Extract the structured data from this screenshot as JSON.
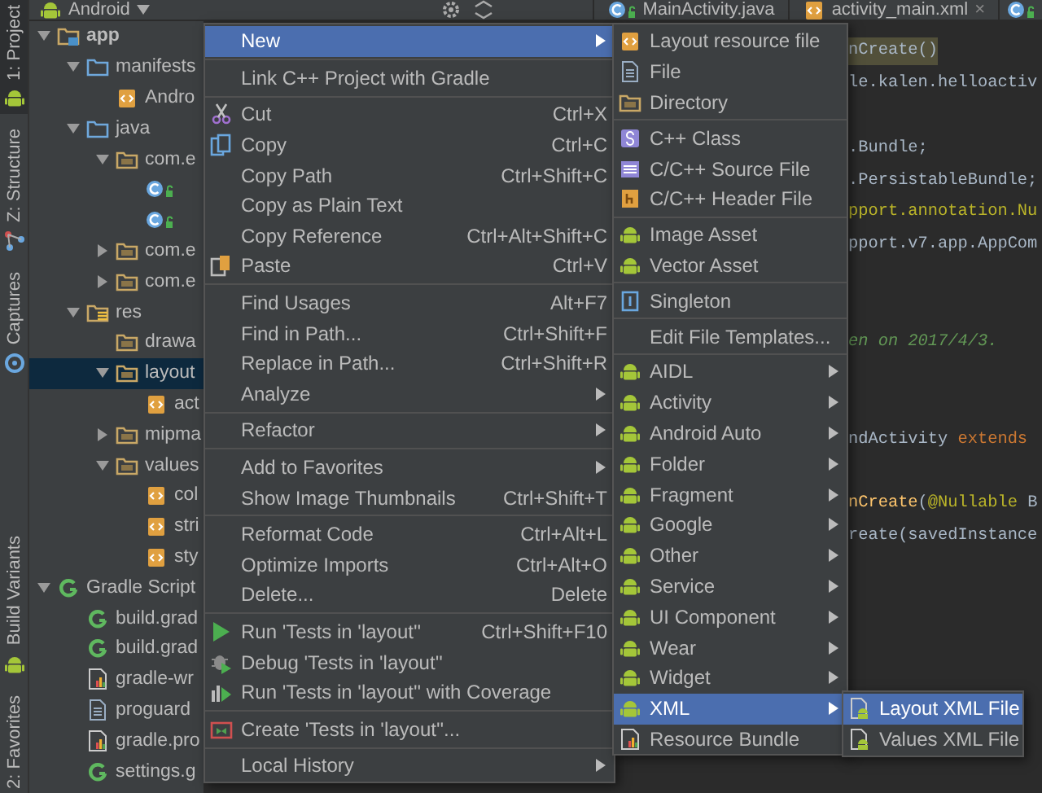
{
  "tool_strip": {
    "top": [
      {
        "label": "1: Project",
        "kind": "android",
        "selected": true
      },
      {
        "label": "Z: Structure",
        "kind": "structure",
        "selected": false
      },
      {
        "label": "Captures",
        "kind": "captures",
        "selected": false
      }
    ],
    "bottom": [
      {
        "label": "Build Variants",
        "kind": "android",
        "selected": false
      },
      {
        "label": "2: Favorites",
        "kind": "plain",
        "selected": false
      }
    ]
  },
  "top_bar": {
    "project_view": "Android",
    "tabs": [
      {
        "label": "MainActivity.java",
        "kind": "class"
      },
      {
        "label": "activity_main.xml",
        "kind": "xml",
        "close": "×"
      }
    ]
  },
  "tree": [
    {
      "label": "app",
      "kind": "module",
      "expanded": true,
      "selected": false,
      "children": [
        {
          "label": "manifests",
          "kind": "folder-blue",
          "expanded": true,
          "selected": false,
          "children": [
            {
              "label": "Andro",
              "kind": "xml",
              "selected": false
            }
          ]
        },
        {
          "label": "java",
          "kind": "folder-blue",
          "expanded": true,
          "selected": false,
          "children": [
            {
              "label": "com.e",
              "kind": "folder",
              "expanded": true,
              "selected": false,
              "children": [
                {
                  "kind": "class",
                  "selected": false
                },
                {
                  "kind": "class",
                  "selected": false
                }
              ]
            },
            {
              "label": "com.e",
              "kind": "folder",
              "expanded": false,
              "selected": false
            },
            {
              "label": "com.e",
              "kind": "folder",
              "expanded": false,
              "selected": false
            }
          ]
        },
        {
          "label": "res",
          "kind": "res-folder",
          "expanded": true,
          "selected": false,
          "children": [
            {
              "label": "drawa",
              "kind": "folder",
              "selected": false
            },
            {
              "label": "layout",
              "kind": "folder",
              "expanded": true,
              "selected": true,
              "children": [
                {
                  "label": "act",
                  "kind": "xml",
                  "selected": false
                }
              ]
            },
            {
              "label": "mipma",
              "kind": "folder",
              "expanded": false,
              "selected": false
            },
            {
              "label": "values",
              "kind": "folder",
              "expanded": true,
              "selected": false,
              "children": [
                {
                  "label": "col",
                  "kind": "xml",
                  "selected": false
                },
                {
                  "label": "stri",
                  "kind": "xml",
                  "selected": false
                },
                {
                  "label": "sty",
                  "kind": "xml",
                  "selected": false
                }
              ]
            }
          ]
        }
      ]
    },
    {
      "label": "Gradle Script",
      "kind": "gradle",
      "expanded": true,
      "selected": false,
      "children": [
        {
          "label": "build.grad",
          "kind": "gradle",
          "selected": false
        },
        {
          "label": "build.grad",
          "kind": "gradle",
          "selected": false
        },
        {
          "label": "gradle-wr",
          "kind": "chart-file",
          "selected": false
        },
        {
          "label": "proguard",
          "kind": "file",
          "selected": false
        },
        {
          "label": "gradle.pro",
          "kind": "chart-file",
          "selected": false
        },
        {
          "label": "settings.g",
          "kind": "gradle",
          "selected": false
        }
      ]
    }
  ],
  "editor": {
    "lines": [
      {
        "kind": "code",
        "segments": [
          {
            "text": "nCreate()",
            "kind": "highlight"
          }
        ]
      },
      {
        "kind": "code",
        "segments": [
          {
            "text": "le.kalen.helloactiv",
            "kind": "plain"
          }
        ]
      },
      {
        "kind": "blank"
      },
      {
        "kind": "code",
        "segments": [
          {
            "text": ".Bundle;",
            "kind": "plain"
          }
        ]
      },
      {
        "kind": "code",
        "segments": [
          {
            "text": ".PersistableBundle;",
            "kind": "plain"
          }
        ]
      },
      {
        "kind": "code",
        "segments": [
          {
            "text": "pport.annotation.Nu",
            "kind": "annotation"
          }
        ]
      },
      {
        "kind": "code",
        "segments": [
          {
            "text": "pport.v7.app.AppCom",
            "kind": "plain"
          }
        ]
      },
      {
        "kind": "blank"
      },
      {
        "kind": "blank"
      },
      {
        "kind": "code",
        "segments": [
          {
            "text": "en on 2017/4/3.",
            "kind": "comment"
          }
        ]
      },
      {
        "kind": "blank"
      },
      {
        "kind": "blank"
      },
      {
        "kind": "code",
        "segments": [
          {
            "text": "ndActivity ",
            "kind": "plain"
          },
          {
            "text": "extends",
            "kind": "keyword"
          }
        ]
      },
      {
        "kind": "blank"
      },
      {
        "kind": "code",
        "segments": [
          {
            "text": "nCreate",
            "kind": "method"
          },
          {
            "text": "(",
            "kind": "plain"
          },
          {
            "text": "@Nullable",
            "kind": "annotation"
          },
          {
            "text": " B",
            "kind": "plain"
          }
        ]
      },
      {
        "kind": "code",
        "segments": [
          {
            "text": "reate(savedInstance",
            "kind": "plain"
          }
        ]
      }
    ]
  },
  "context_menu": {
    "items": [
      {
        "kind": "plain",
        "label": "New",
        "submenu": true,
        "selected": true
      },
      {
        "kind": "separator"
      },
      {
        "kind": "plain",
        "label": "Link C++ Project with Gradle",
        "submenu": false,
        "selected": false
      },
      {
        "kind": "separator"
      },
      {
        "kind": "scissors",
        "label": "Cut",
        "shortcut": "Ctrl+X",
        "submenu": false,
        "selected": false
      },
      {
        "kind": "copy",
        "label": "Copy",
        "shortcut": "Ctrl+C",
        "submenu": false,
        "selected": false
      },
      {
        "kind": "plain",
        "label": "Copy Path",
        "shortcut": "Ctrl+Shift+C",
        "submenu": false,
        "selected": false
      },
      {
        "kind": "plain",
        "label": "Copy as Plain Text",
        "submenu": false,
        "selected": false
      },
      {
        "kind": "plain",
        "label": "Copy Reference",
        "shortcut": "Ctrl+Alt+Shift+C",
        "submenu": false,
        "selected": false
      },
      {
        "kind": "paste",
        "label": "Paste",
        "shortcut": "Ctrl+V",
        "submenu": false,
        "selected": false
      },
      {
        "kind": "separator"
      },
      {
        "kind": "plain",
        "label": "Find Usages",
        "shortcut": "Alt+F7",
        "submenu": false,
        "selected": false
      },
      {
        "kind": "plain",
        "label": "Find in Path...",
        "shortcut": "Ctrl+Shift+F",
        "submenu": false,
        "selected": false
      },
      {
        "kind": "plain",
        "label": "Replace in Path...",
        "shortcut": "Ctrl+Shift+R",
        "submenu": false,
        "selected": false
      },
      {
        "kind": "plain",
        "label": "Analyze",
        "submenu": true,
        "selected": false
      },
      {
        "kind": "separator"
      },
      {
        "kind": "plain",
        "label": "Refactor",
        "submenu": true,
        "selected": false
      },
      {
        "kind": "separator"
      },
      {
        "kind": "plain",
        "label": "Add to Favorites",
        "submenu": true,
        "selected": false
      },
      {
        "kind": "plain",
        "label": "Show Image Thumbnails",
        "shortcut": "Ctrl+Shift+T",
        "submenu": false,
        "selected": false
      },
      {
        "kind": "separator"
      },
      {
        "kind": "plain",
        "label": "Reformat Code",
        "shortcut": "Ctrl+Alt+L",
        "submenu": false,
        "selected": false
      },
      {
        "kind": "plain",
        "label": "Optimize Imports",
        "shortcut": "Ctrl+Alt+O",
        "submenu": false,
        "selected": false
      },
      {
        "kind": "plain",
        "label": "Delete...",
        "shortcut": "Delete",
        "submenu": false,
        "selected": false
      },
      {
        "kind": "separator"
      },
      {
        "kind": "run",
        "label": "Run 'Tests in 'layout''",
        "shortcut": "Ctrl+Shift+F10",
        "submenu": false,
        "selected": false
      },
      {
        "kind": "debug",
        "label": "Debug 'Tests in 'layout''",
        "submenu": false,
        "selected": false
      },
      {
        "kind": "coverage",
        "label": "Run 'Tests in 'layout'' with Coverage",
        "submenu": false,
        "selected": false
      },
      {
        "kind": "separator"
      },
      {
        "kind": "test",
        "label": "Create 'Tests in 'layout''...",
        "submenu": false,
        "selected": false
      },
      {
        "kind": "separator"
      },
      {
        "kind": "plain",
        "label": "Local History",
        "submenu": true,
        "selected": false
      }
    ]
  },
  "new_submenu": {
    "items": [
      {
        "kind": "xml",
        "label": "Layout resource file",
        "submenu": false,
        "selected": false
      },
      {
        "kind": "file",
        "label": "File",
        "submenu": false,
        "selected": false
      },
      {
        "kind": "folder",
        "label": "Directory",
        "submenu": false,
        "selected": false
      },
      {
        "kind": "separator"
      },
      {
        "kind": "cpp-class",
        "label": "C++ Class",
        "submenu": false,
        "selected": false
      },
      {
        "kind": "cpp-source",
        "label": "C/C++ Source File",
        "submenu": false,
        "selected": false
      },
      {
        "kind": "cpp-header",
        "label": "C/C++ Header File",
        "submenu": false,
        "selected": false
      },
      {
        "kind": "separator"
      },
      {
        "kind": "android",
        "label": "Image Asset",
        "submenu": false,
        "selected": false
      },
      {
        "kind": "android",
        "label": "Vector Asset",
        "submenu": false,
        "selected": false
      },
      {
        "kind": "separator"
      },
      {
        "kind": "singleton",
        "label": "Singleton",
        "submenu": false,
        "selected": false
      },
      {
        "kind": "separator"
      },
      {
        "kind": "plain",
        "label": "Edit File Templates...",
        "submenu": false,
        "selected": false
      },
      {
        "kind": "separator"
      },
      {
        "kind": "android",
        "label": "AIDL",
        "submenu": true,
        "selected": false
      },
      {
        "kind": "android",
        "label": "Activity",
        "submenu": true,
        "selected": false
      },
      {
        "kind": "android",
        "label": "Android Auto",
        "submenu": true,
        "selected": false
      },
      {
        "kind": "android",
        "label": "Folder",
        "submenu": true,
        "selected": false
      },
      {
        "kind": "android",
        "label": "Fragment",
        "submenu": true,
        "selected": false
      },
      {
        "kind": "android",
        "label": "Google",
        "submenu": true,
        "selected": false
      },
      {
        "kind": "android",
        "label": "Other",
        "submenu": true,
        "selected": false
      },
      {
        "kind": "android",
        "label": "Service",
        "submenu": true,
        "selected": false
      },
      {
        "kind": "android",
        "label": "UI Component",
        "submenu": true,
        "selected": false
      },
      {
        "kind": "android",
        "label": "Wear",
        "submenu": true,
        "selected": false
      },
      {
        "kind": "android",
        "label": "Widget",
        "submenu": true,
        "selected": false
      },
      {
        "kind": "android",
        "label": "XML",
        "submenu": true,
        "selected": true
      },
      {
        "kind": "chart-file",
        "label": "Resource Bundle",
        "submenu": false,
        "selected": false
      }
    ]
  },
  "xml_submenu": {
    "items": [
      {
        "kind": "android-file",
        "label": "Layout XML File",
        "submenu": false,
        "selected": true
      },
      {
        "kind": "android-file",
        "label": "Values XML File",
        "submenu": false,
        "selected": false
      }
    ]
  }
}
